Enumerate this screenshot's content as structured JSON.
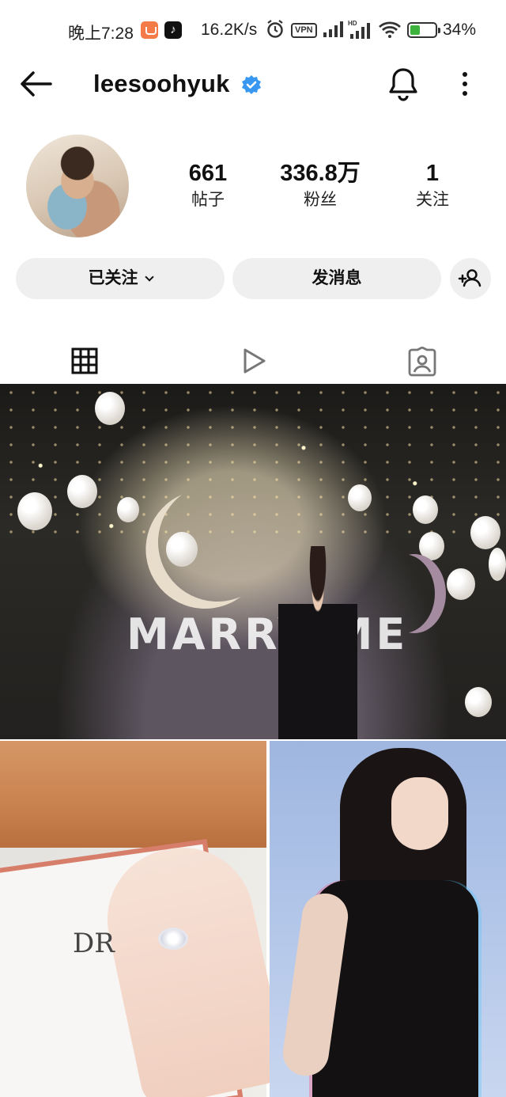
{
  "status_bar": {
    "time": "晚上7:28",
    "net_speed": "16.2K/s",
    "vpn": "VPN",
    "hd": "HD",
    "battery": "34%"
  },
  "header": {
    "username": "leesoohyuk",
    "verified": true,
    "icons": [
      "back-arrow-icon",
      "verified-badge-icon",
      "bell-icon",
      "more-vert-icon"
    ]
  },
  "profile": {
    "stats": [
      {
        "value": "661",
        "label": "帖子"
      },
      {
        "value": "336.8万",
        "label": "粉丝"
      },
      {
        "value": "1",
        "label": "关注"
      }
    ]
  },
  "actions": {
    "following_label": "已关注",
    "message_label": "发消息",
    "add_user_icon": "add-user-icon"
  },
  "tabs": [
    {
      "name": "grid",
      "icon": "grid-icon",
      "active": true
    },
    {
      "name": "reels",
      "icon": "play-icon",
      "active": false
    },
    {
      "name": "tagged",
      "icon": "tagged-person-icon",
      "active": false
    }
  ],
  "posts": {
    "post_1_sign": "MARRY ME",
    "post_2_card_logo": "DR"
  },
  "colors": {
    "button_bg": "#efefef",
    "verified_blue": "#3897f0",
    "text": "#111111",
    "battery_green": "#3db33d"
  }
}
